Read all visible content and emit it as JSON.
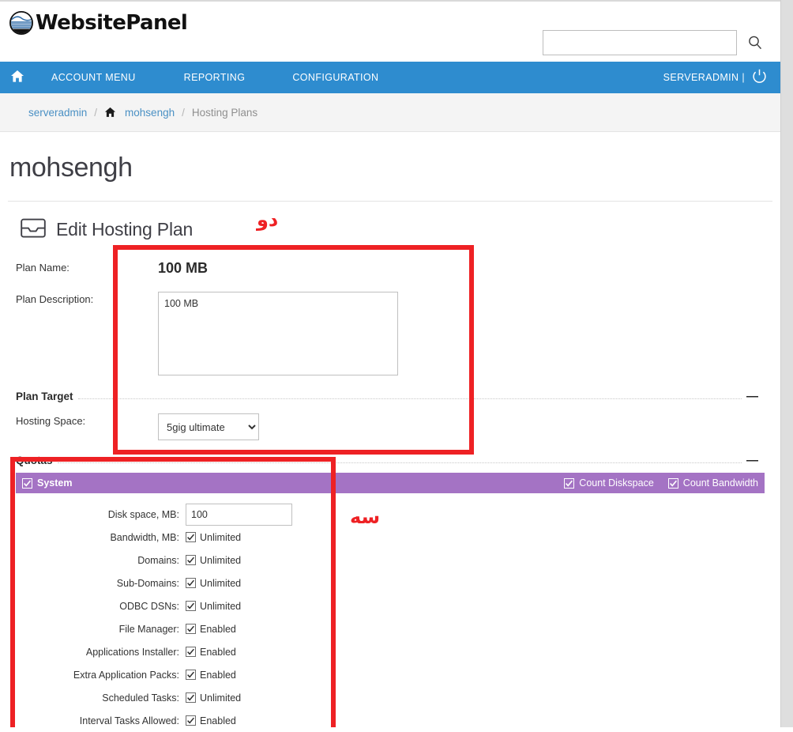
{
  "branding": {
    "logo_text": "WebsitePanel",
    "logo_icon": "globe-logo-icon"
  },
  "search": {
    "value": "",
    "placeholder": "",
    "icon": "search-icon"
  },
  "navbar": {
    "home_icon": "home-icon",
    "items": [
      {
        "label": "ACCOUNT MENU"
      },
      {
        "label": "REPORTING"
      },
      {
        "label": "CONFIGURATION"
      }
    ],
    "user_label": "SERVERADMIN |",
    "logout_icon": "power-icon",
    "background_color": "#2e8ccf"
  },
  "breadcrumb": {
    "items": [
      {
        "label": "serveradmin",
        "type": "link",
        "icon": null
      },
      {
        "label": "mohsengh",
        "type": "link",
        "icon": "home-icon"
      },
      {
        "label": "Hosting Plans",
        "type": "current",
        "icon": null
      }
    ],
    "separator": "/"
  },
  "page": {
    "title": "mohsengh",
    "section_icon": "inbox-tray-icon",
    "section_title": "Edit Hosting Plan"
  },
  "form": {
    "plan_name_label": "Plan Name:",
    "plan_name_value": "100 MB",
    "plan_description_label": "Plan Description:",
    "plan_description_value": "100 MB",
    "plan_target_heading": "Plan Target",
    "hosting_space_label": "Hosting Space:",
    "hosting_space_value": "5gig ultimate",
    "hosting_space_options": [
      "5gig ultimate"
    ],
    "quotas_heading": "Quotas",
    "collapse_glyph": "—"
  },
  "quotas": {
    "group_label": "System",
    "group_checked": true,
    "header_color": "#a473c4",
    "header_options": [
      {
        "label": "Count Diskspace",
        "checked": true
      },
      {
        "label": "Count Bandwidth",
        "checked": true
      }
    ],
    "rows": [
      {
        "label": "Disk space, MB:",
        "control": "text",
        "value": "100",
        "checked": false
      },
      {
        "label": "Bandwidth, MB:",
        "control": "checkbox",
        "value": "Unlimited",
        "checked": true
      },
      {
        "label": "Domains:",
        "control": "checkbox",
        "value": "Unlimited",
        "checked": true
      },
      {
        "label": "Sub-Domains:",
        "control": "checkbox",
        "value": "Unlimited",
        "checked": true
      },
      {
        "label": "ODBC DSNs:",
        "control": "checkbox",
        "value": "Unlimited",
        "checked": true
      },
      {
        "label": "File Manager:",
        "control": "checkbox",
        "value": "Enabled",
        "checked": true
      },
      {
        "label": "Applications Installer:",
        "control": "checkbox",
        "value": "Enabled",
        "checked": true
      },
      {
        "label": "Extra Application Packs:",
        "control": "checkbox",
        "value": "Enabled",
        "checked": true
      },
      {
        "label": "Scheduled Tasks:",
        "control": "checkbox",
        "value": "Unlimited",
        "checked": true
      },
      {
        "label": "Interval Tasks Allowed:",
        "control": "checkbox",
        "value": "Enabled",
        "checked": true
      }
    ]
  },
  "annotations": {
    "color": "#ee2124",
    "labels": [
      {
        "text": "دو"
      },
      {
        "text": "سه"
      }
    ]
  }
}
